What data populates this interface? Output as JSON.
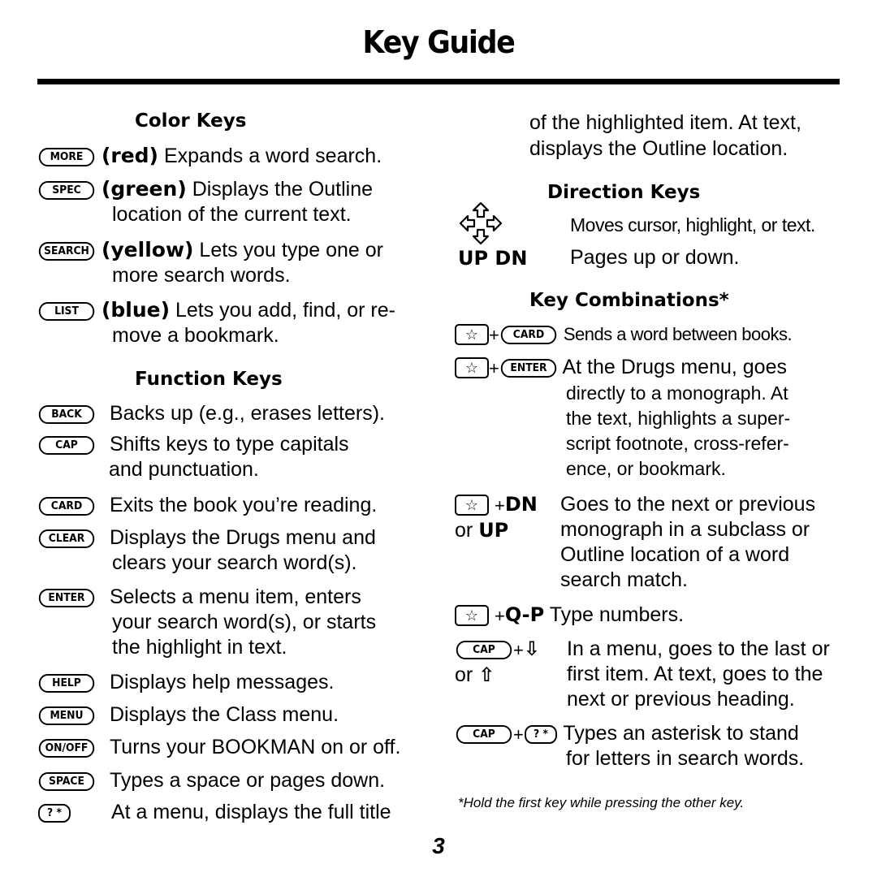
{
  "page": {
    "title": "Key Guide",
    "page_number": "3",
    "footnote": "*Hold the first key while pressing the other key."
  },
  "color_keys": {
    "heading": "Color Keys",
    "items": [
      {
        "key": "MORE",
        "color": "(red)",
        "lines": [
          "Expands a word search."
        ]
      },
      {
        "key": "SPEC",
        "color": "(green)",
        "lines": [
          "Displays the Outline",
          "location of the current text."
        ]
      },
      {
        "key": "SEARCH",
        "color": "(yellow)",
        "lines": [
          "Lets you type one or",
          "more search words."
        ]
      },
      {
        "key": "LIST",
        "color": "(blue)",
        "lines": [
          "Lets you add, find, or re-",
          "move a bookmark."
        ]
      }
    ]
  },
  "function_keys": {
    "heading": "Function Keys",
    "items": [
      {
        "key": "BACK",
        "lines": [
          "Backs up (e.g., erases letters)."
        ]
      },
      {
        "key": "CAP",
        "lines": [
          "Shifts keys to type capitals",
          "and punctuation."
        ]
      },
      {
        "key": "CARD",
        "lines": [
          "Exits the book you’re reading."
        ]
      },
      {
        "key": "CLEAR",
        "lines": [
          "Displays the Drugs menu and",
          "clears your search word(s)."
        ]
      },
      {
        "key": "ENTER",
        "lines": [
          "Selects a menu item, enters",
          "your search word(s), or starts",
          "the highlight in text."
        ]
      },
      {
        "key": "HELP",
        "lines": [
          "Displays help messages."
        ]
      },
      {
        "key": "MENU",
        "lines": [
          "Displays the Class menu."
        ]
      },
      {
        "key": "ON/OFF",
        "lines": [
          "Turns your BOOKMAN on or off."
        ]
      },
      {
        "key": "SPACE",
        "lines": [
          "Types a space or pages down."
        ]
      },
      {
        "key": "? *",
        "lines": [
          "At a menu, displays the full title",
          "of the highlighted item. At text,",
          "displays the Outline location."
        ]
      }
    ]
  },
  "direction_keys": {
    "heading": "Direction Keys",
    "items": [
      {
        "key_icon": "arrow-keys-icon",
        "lines": [
          "Moves cursor, highlight, or text."
        ]
      },
      {
        "key": "UP DN",
        "lines": [
          "Pages up or down."
        ]
      }
    ]
  },
  "key_combinations": {
    "heading": "Key Combinations*",
    "items": [
      {
        "first": "☆",
        "plus": "+",
        "second": "CARD",
        "lines": [
          "Sends a word between books."
        ]
      },
      {
        "first": "☆",
        "plus": "+",
        "second": "ENTER",
        "lines": [
          "At the Drugs menu, goes",
          "directly to a monograph. At",
          "the text, highlights a super-",
          "script footnote, cross-refer-",
          "ence, or bookmark."
        ]
      },
      {
        "first": "☆",
        "plus": "+",
        "second": "DN",
        "alt_prefix": "or",
        "alt": "UP",
        "lines": [
          "Goes to the next or previous",
          "monograph in a subclass or",
          "Outline location of a word",
          "search match."
        ]
      },
      {
        "first": "☆",
        "plus": "+",
        "second": "Q-P",
        "lines": [
          "Type numbers."
        ]
      },
      {
        "first": "CAP",
        "plus": "+",
        "second": "⇩",
        "alt_prefix": "or",
        "alt": "⇧",
        "lines": [
          "In a menu, goes to the last or",
          "first item. At text, goes to the",
          "next or previous heading."
        ]
      },
      {
        "first": "CAP",
        "plus": "+",
        "second": "? *",
        "lines": [
          "Types an asterisk to stand",
          "for letters in search words."
        ]
      }
    ]
  }
}
